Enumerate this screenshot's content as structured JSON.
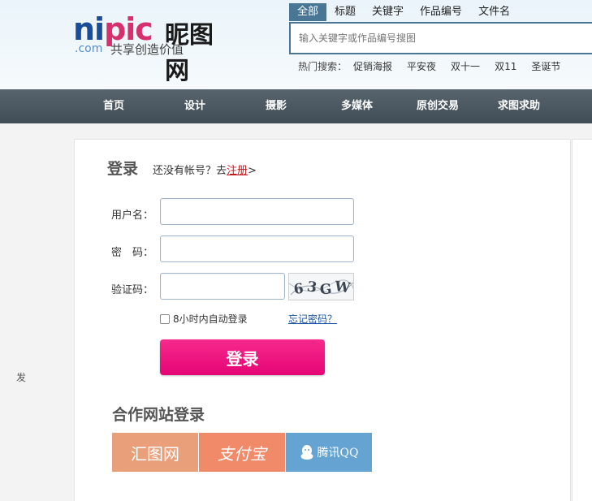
{
  "header": {
    "logo_text_a": "ni",
    "logo_text_b": "pic",
    "logo_cn": "昵图网",
    "logo_com": ".com",
    "slogan": "共享创造价值"
  },
  "search": {
    "tabs": [
      "全部",
      "标题",
      "关键字",
      "作品编号",
      "文件名"
    ],
    "placeholder": "输入关键字或作品编号搜图",
    "hot_label": "热门搜索：",
    "hot_items": [
      "促销海报",
      "平安夜",
      "双十一",
      "双11",
      "圣诞节"
    ]
  },
  "nav": {
    "items": [
      "首页",
      "设计",
      "摄影",
      "多媒体",
      "原创交易",
      "求图求助"
    ]
  },
  "login": {
    "title": "登录",
    "no_account": "还没有帐号？去",
    "register": "注册",
    "arrow": ">",
    "username_label": "用户名：",
    "password_label": "密　码：",
    "captcha_label": "验证码：",
    "captcha_text": "63GW",
    "remember_label": "8小时内自动登录",
    "forgot_label": "忘记密码？",
    "submit_label": "登录"
  },
  "partners": {
    "title": "合作网站登录",
    "huitu": "汇图网",
    "alipay": "支付宝",
    "qq": "腾讯QQ"
  },
  "side": {
    "char": "发"
  },
  "colors": {
    "accent": "#e40575",
    "nav_bg": "#414d56",
    "tab_active": "#4a7696",
    "link": "#1b57a6"
  }
}
